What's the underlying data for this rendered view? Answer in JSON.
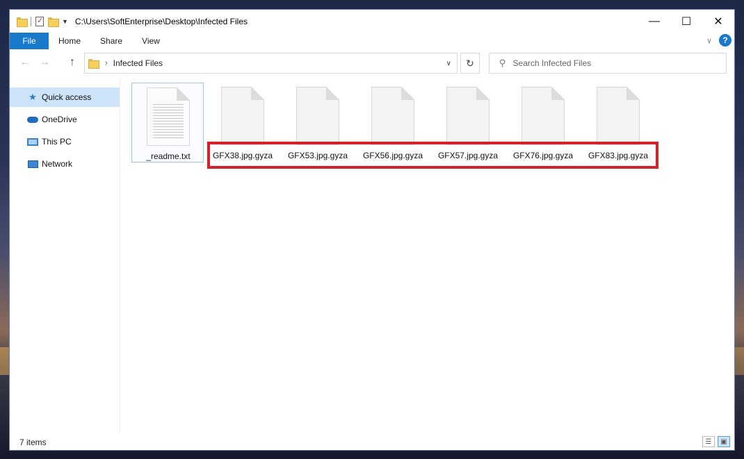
{
  "window": {
    "path_title": "C:\\Users\\SoftEnterprise\\Desktop\\Infected Files",
    "controls": {
      "minimize": "—",
      "maximize": "☐",
      "close": "✕"
    }
  },
  "ribbon": {
    "tabs": [
      "File",
      "Home",
      "Share",
      "View"
    ],
    "collapse_icon": "chevron-down-icon",
    "help_label": "?"
  },
  "address": {
    "location": "Infected Files",
    "search_placeholder": "Search Infected Files"
  },
  "sidebar": {
    "items": [
      {
        "label": "Quick access",
        "icon": "star-icon",
        "active": true
      },
      {
        "label": "OneDrive",
        "icon": "cloud-icon",
        "active": false
      },
      {
        "label": "This PC",
        "icon": "computer-icon",
        "active": false
      },
      {
        "label": "Network",
        "icon": "network-icon",
        "active": false
      }
    ]
  },
  "files": [
    {
      "name": "_readme.txt",
      "type": "text"
    },
    {
      "name": "GFX38.jpg.gyza",
      "type": "blank"
    },
    {
      "name": "GFX53.jpg.gyza",
      "type": "blank"
    },
    {
      "name": "GFX56.jpg.gyza",
      "type": "blank"
    },
    {
      "name": "GFX57.jpg.gyza",
      "type": "blank"
    },
    {
      "name": "GFX76.jpg.gyza",
      "type": "blank"
    },
    {
      "name": "GFX83.jpg.gyza",
      "type": "blank"
    }
  ],
  "highlight": {
    "color": "#d8202a"
  },
  "status": {
    "item_count": "7 items"
  },
  "colors": {
    "accent": "#1979ca",
    "selection": "#cde3f7"
  }
}
